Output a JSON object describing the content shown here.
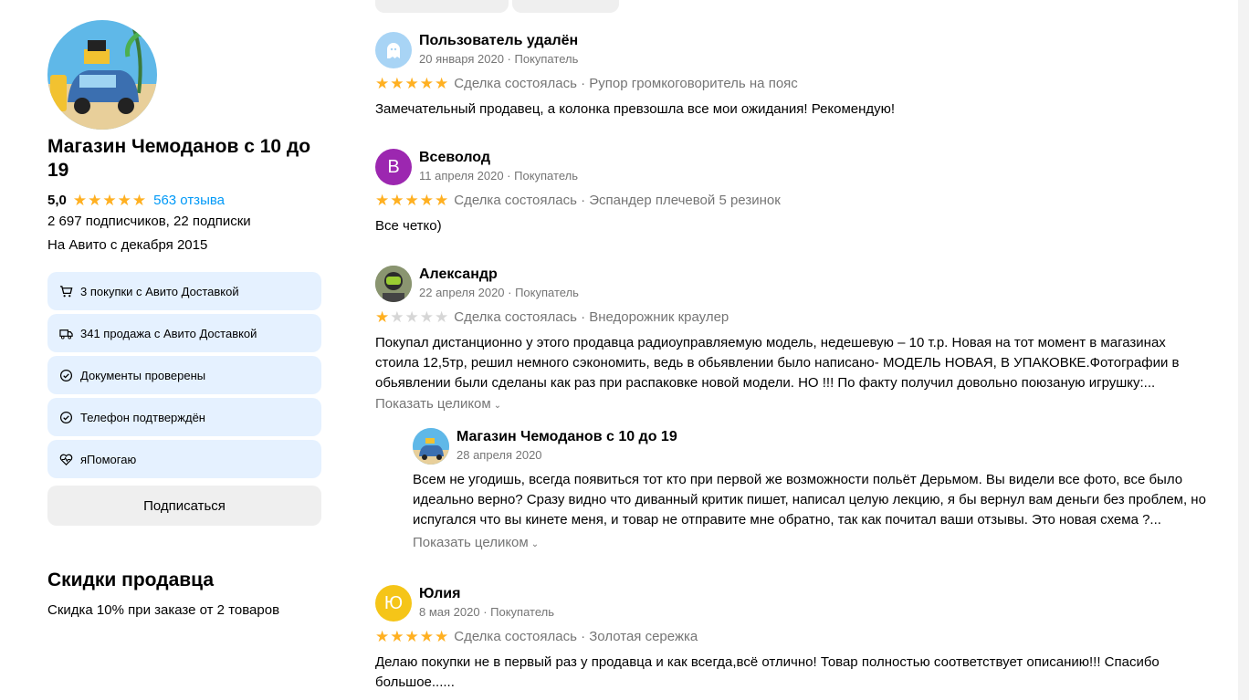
{
  "seller": {
    "name": "Магазин Чемоданов с 10 до 19",
    "rating_value": "5,0",
    "rating_stars": 5,
    "reviews_link": "563 отзыва",
    "subscribers": "2 697 подписчиков, 22 подписки",
    "since": "На Авито с декабря 2015",
    "badges": [
      {
        "label": "3 покупки с Авито Доставкой",
        "icon": "cart-icon"
      },
      {
        "label": "341 продажа с Авито Доставкой",
        "icon": "truck-icon"
      },
      {
        "label": "Документы проверены",
        "icon": "check-circle-icon"
      },
      {
        "label": "Телефон подтверждён",
        "icon": "check-circle-icon"
      },
      {
        "label": "яПомогаю",
        "icon": "heart-pulse-icon"
      }
    ],
    "subscribe_label": "Подписаться"
  },
  "discounts": {
    "title": "Скидки продавца",
    "text": "Скидка 10% при заказе от 2 товаров"
  },
  "colors": {
    "star": "#ffb021",
    "link": "#0099f7",
    "badge_bg": "#e5f1ff",
    "meta": "#757575"
  },
  "reviews": [
    {
      "author": "Пользователь удалён",
      "meta": "20 января 2020 · Покупатель",
      "stars": 5,
      "deal": "Сделка состоялась · Рупор громкоговоритель на пояс",
      "text": "Замечательный продавец, а колонка превзошла все мои ожидания! Рекомендую!",
      "avatar": "ghost-icon"
    },
    {
      "author": "Всеволод",
      "meta": "11 апреля 2020 · Покупатель",
      "stars": 5,
      "deal": "Сделка состоялась · Эспандер плечевой 5 резинок",
      "text": "Все четко)",
      "avatar_letter": "В",
      "avatar_color": "#9c27b0"
    },
    {
      "author": "Александр",
      "meta": "22 апреля 2020 · Покупатель",
      "stars": 1,
      "deal": "Сделка состоялась · Внедорожник краулер",
      "text": "Покупал дистанционно у этого продавца радиоуправляемую модель, недешевую – 10 т.р. Новая на тот момент в магазинах стоила 12,5тр, решил немного сэкономить, ведь в обьявлении было написано- МОДЕЛЬ НОВАЯ, В УПАКОВКЕ.Фотографии в обьявлении были сделаны как раз при распаковке новой модели. НО !!! По факту получил довольно поюзаную игрушку:...",
      "show_full": "Показать целиком",
      "avatar": "diver-photo"
    },
    {
      "author": "Юлия",
      "meta": "8 мая 2020 · Покупатель",
      "stars": 5,
      "deal": "Сделка состоялась · Золотая сережка",
      "text": "Делаю покупки не в первый раз у продавца и как всегда,всё отлично! Товар полностью соответствует описанию!!! Спасибо большое......",
      "avatar_letter": "Ю",
      "avatar_color": "#f5c518"
    }
  ],
  "reply": {
    "author": "Магазин Чемоданов с 10 до 19",
    "date": "28 апреля 2020",
    "text": "Всем не угодишь, всегда появиться тот кто при первой же возможности польёт Дерьмом. Вы видели все фото, все было идеально верно? Сразу видно что диванный критик пишет, написал целую лекцию, я бы вернул вам деньги без проблем, но испугался что вы кинете меня, и товар не отправите мне обратно, так как почитал ваши отзывы. Это новая схема ?...",
    "show_full": "Показать целиком"
  }
}
